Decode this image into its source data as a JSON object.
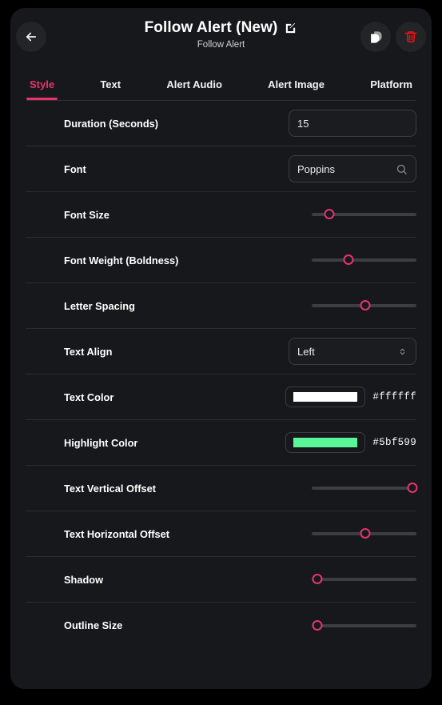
{
  "header": {
    "title": "Follow Alert (New)",
    "subtitle": "Follow Alert",
    "back_icon": "arrow-left-icon",
    "edit_icon": "edit-pencil-icon",
    "copy_icon": "duplicate-icon",
    "delete_icon": "trash-icon"
  },
  "tabs": [
    {
      "label": "Style",
      "active": true
    },
    {
      "label": "Text",
      "active": false
    },
    {
      "label": "Alert Audio",
      "active": false
    },
    {
      "label": "Alert Image",
      "active": false
    },
    {
      "label": "Platform",
      "active": false
    }
  ],
  "accent_color": "#e8336d",
  "rows": [
    {
      "label": "Duration (Seconds)",
      "type": "text",
      "value": "15"
    },
    {
      "label": "Font",
      "type": "search",
      "value": "Poppins",
      "trail_icon": "search-icon"
    },
    {
      "label": "Font Size",
      "type": "slider",
      "percent": 17
    },
    {
      "label": "Font Weight (Boldness)",
      "type": "slider",
      "percent": 35
    },
    {
      "label": "Letter Spacing",
      "type": "slider",
      "percent": 51
    },
    {
      "label": "Text Align",
      "type": "select",
      "value": "Left",
      "trail_icon": "chevron-updown-icon"
    },
    {
      "label": "Text Color",
      "type": "color",
      "value": "#ffffff",
      "swatch": "#ffffff"
    },
    {
      "label": "Highlight Color",
      "type": "color",
      "value": "#5bf599",
      "swatch": "#5bf599"
    },
    {
      "label": "Text Vertical Offset",
      "type": "slider",
      "percent": 96
    },
    {
      "label": "Text Horizontal Offset",
      "type": "slider",
      "percent": 51
    },
    {
      "label": "Shadow",
      "type": "slider",
      "percent": 5
    },
    {
      "label": "Outline Size",
      "type": "slider",
      "percent": 5
    }
  ]
}
